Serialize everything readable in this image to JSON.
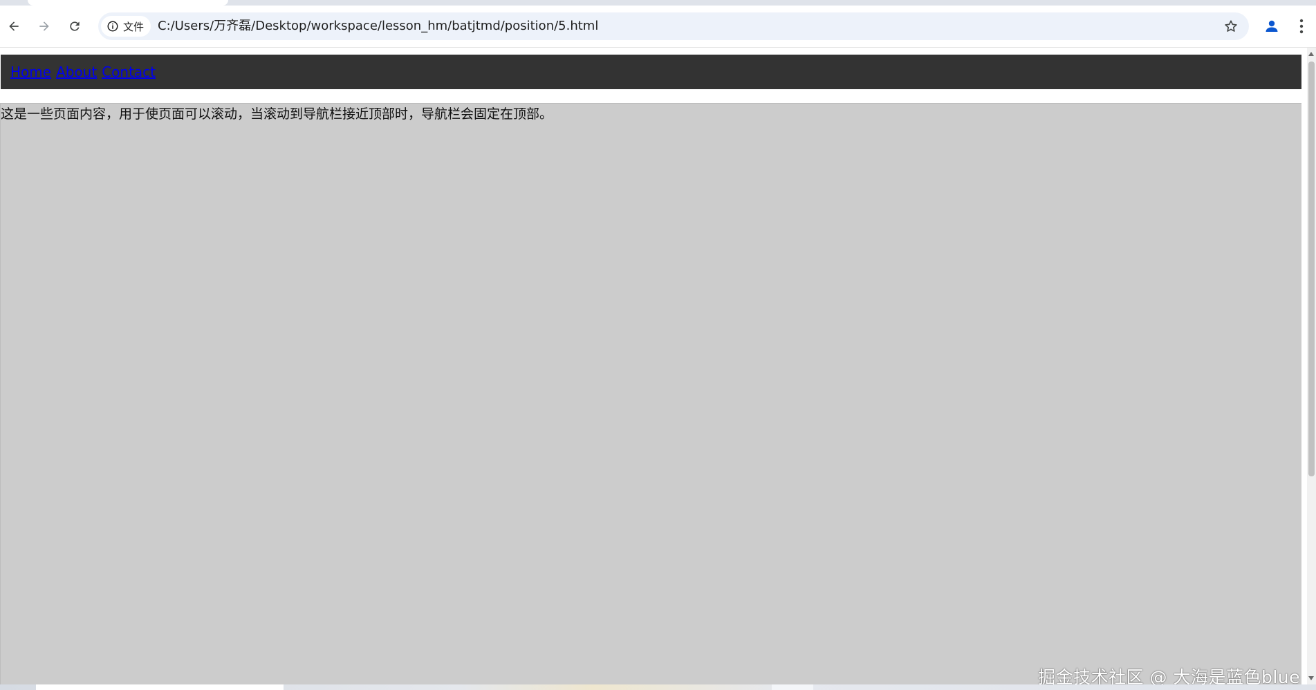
{
  "browser": {
    "toolbar": {
      "back_icon": "arrow-left-icon",
      "forward_icon": "arrow-right-icon",
      "reload_icon": "reload-icon"
    },
    "omnibox": {
      "site_chip_icon": "info-icon",
      "site_chip_label": "文件",
      "url": "C:/Users/万齐磊/Desktop/workspace/lesson_hm/batjtmd/position/5.html",
      "bookmark_icon": "star-icon"
    },
    "profile_icon": "person-icon",
    "menu_icon": "kebab-menu-icon",
    "colors": {
      "omnibox_bg": "#edf2fa",
      "profile_blue": "#0b57d0"
    }
  },
  "page": {
    "navbar": {
      "background": "#333333",
      "links": [
        {
          "label": "Home"
        },
        {
          "label": "About"
        },
        {
          "label": "Contact"
        }
      ],
      "link_color": "#0000ee"
    },
    "content": {
      "background": "#cccccc",
      "text": "这是一些页面内容，用于使页面可以滚动，当滚动到导航栏接近顶部时，导航栏会固定在顶部。"
    },
    "watermark": "掘金技术社区 @ 大海是蓝色blue"
  }
}
